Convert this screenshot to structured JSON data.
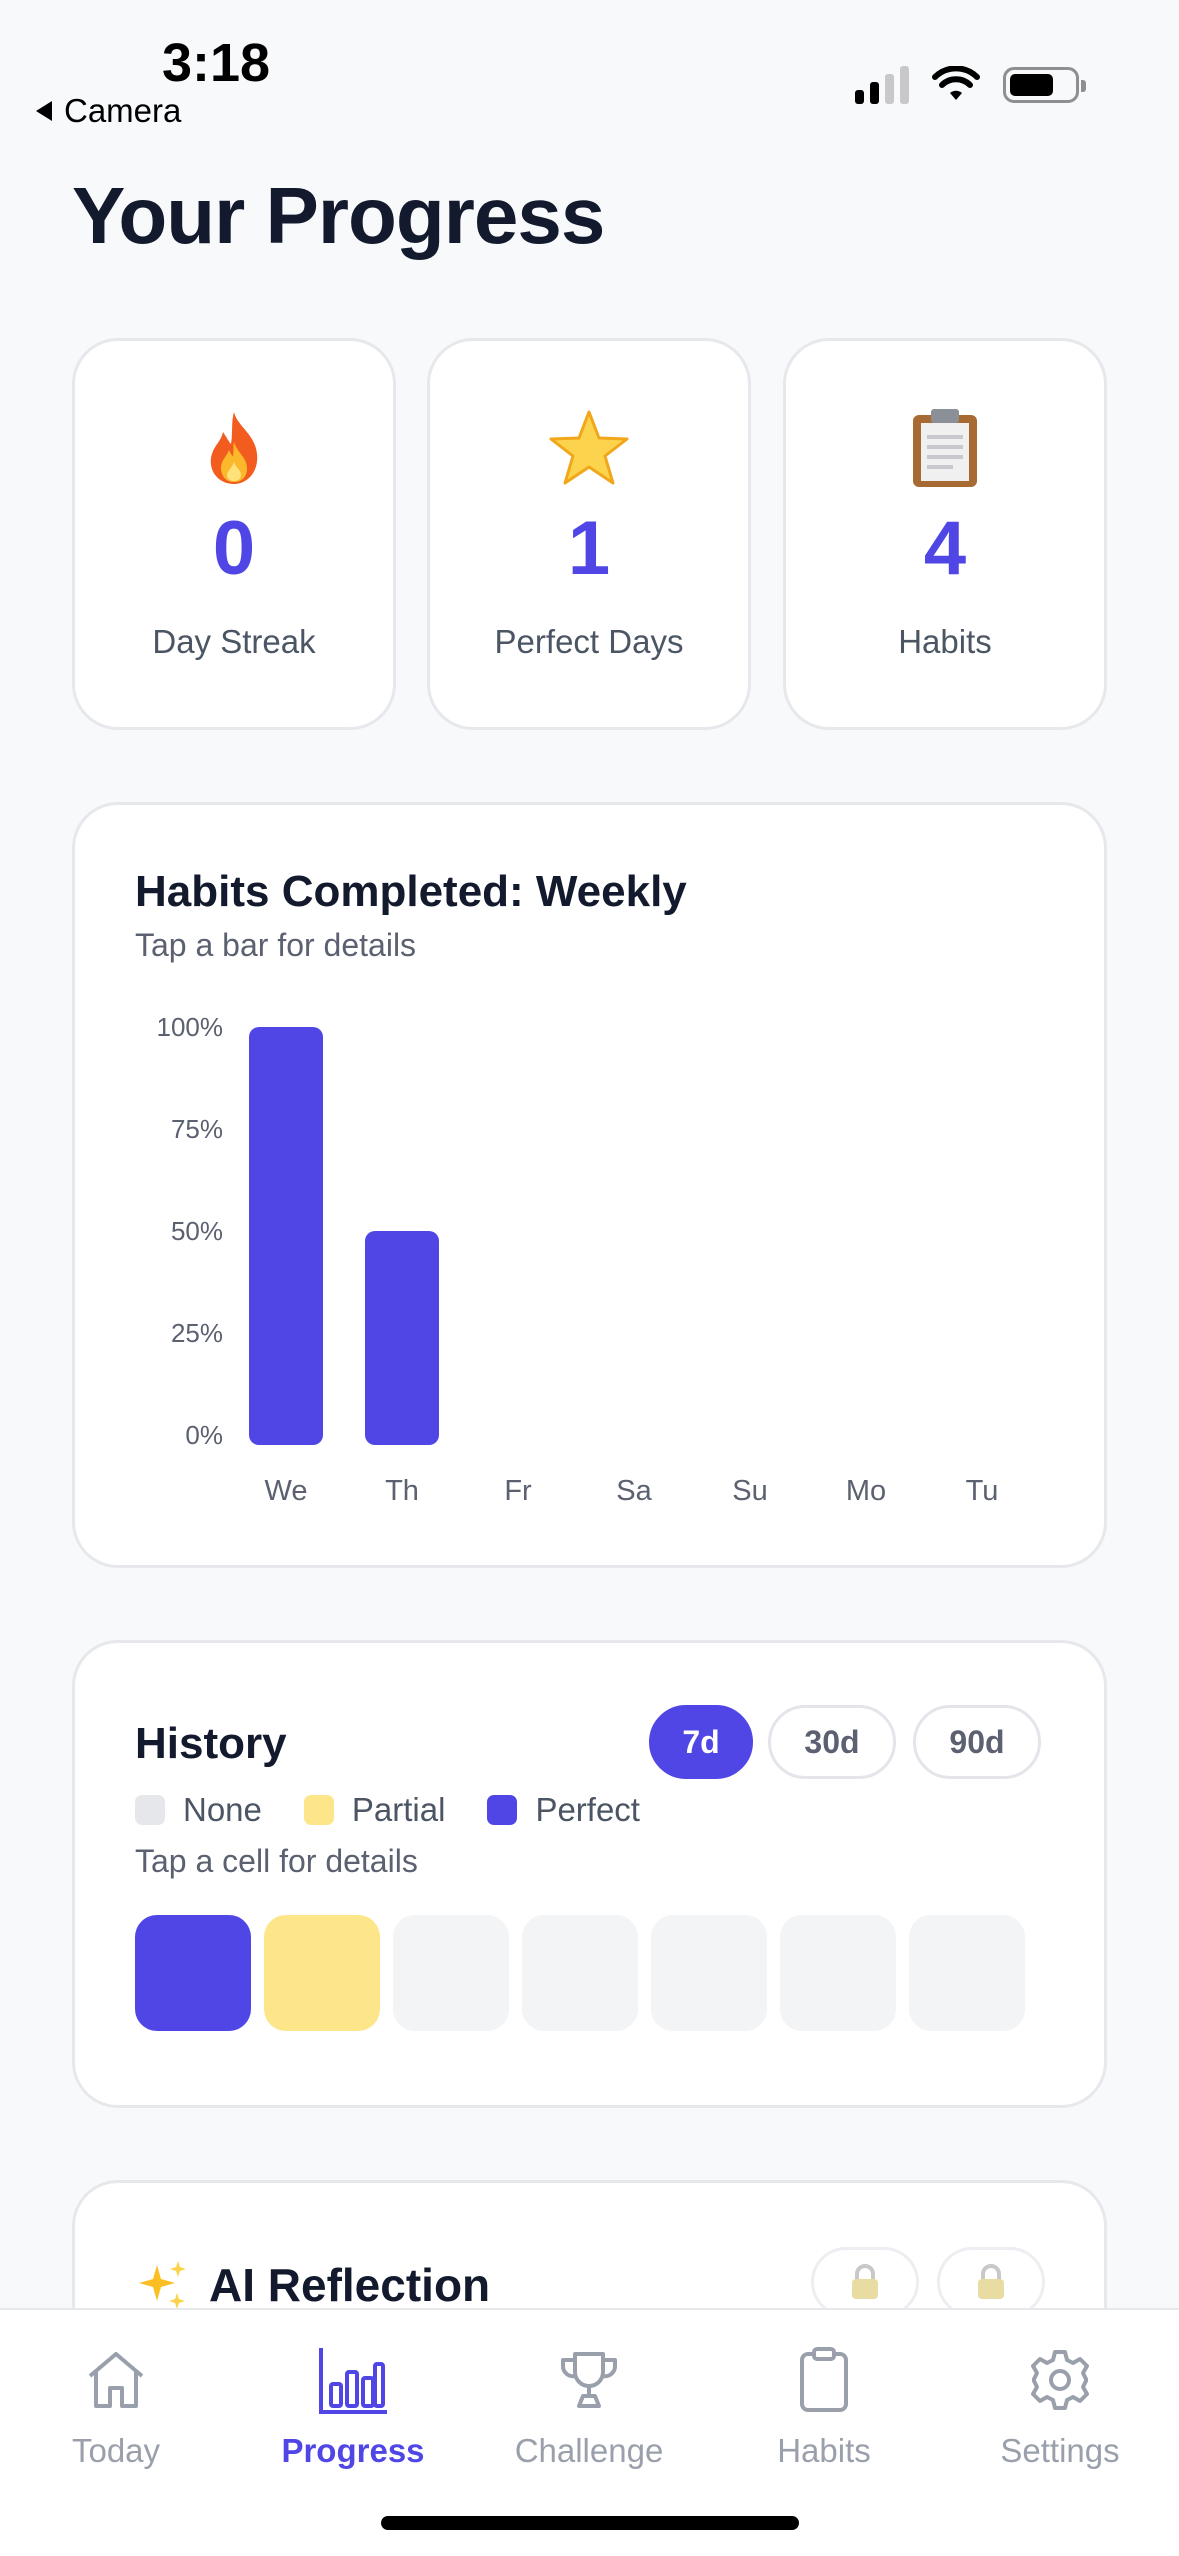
{
  "status": {
    "time": "3:18",
    "back_label": "Camera"
  },
  "page": {
    "title": "Your Progress"
  },
  "stats": [
    {
      "icon": "fire-icon",
      "value": "0",
      "label": "Day Streak"
    },
    {
      "icon": "star-icon",
      "value": "1",
      "label": "Perfect Days"
    },
    {
      "icon": "clipboard-icon",
      "value": "4",
      "label": "Habits"
    }
  ],
  "chart": {
    "title": "Habits Completed: Weekly",
    "subtitle": "Tap a bar for details"
  },
  "chart_data": {
    "type": "bar",
    "categories": [
      "We",
      "Th",
      "Fr",
      "Sa",
      "Su",
      "Mo",
      "Tu"
    ],
    "values": [
      100,
      50,
      0,
      0,
      0,
      0,
      0
    ],
    "yticks": [
      "100%",
      "75%",
      "50%",
      "25%",
      "0%"
    ],
    "ylim": [
      0,
      100
    ],
    "grid": false,
    "bar_color": "#4f46e5"
  },
  "history": {
    "title": "History",
    "ranges": [
      "7d",
      "30d",
      "90d"
    ],
    "active_range": "7d",
    "legend": [
      {
        "label": "None",
        "color": "#e5e7eb"
      },
      {
        "label": "Partial",
        "color": "#fde68a"
      },
      {
        "label": "Perfect",
        "color": "#4f46e5"
      }
    ],
    "hint": "Tap a cell for details",
    "cells": [
      "perfect",
      "partial",
      "none",
      "none",
      "none",
      "none",
      "none"
    ]
  },
  "ai": {
    "title": "AI Reflection",
    "icon": "sparkles-icon"
  },
  "tabs": [
    {
      "label": "Today",
      "icon": "home-icon",
      "active": false
    },
    {
      "label": "Progress",
      "icon": "bar-chart-icon",
      "active": true
    },
    {
      "label": "Challenge",
      "icon": "trophy-icon",
      "active": false
    },
    {
      "label": "Habits",
      "icon": "clipboard-outline-icon",
      "active": false
    },
    {
      "label": "Settings",
      "icon": "gear-icon",
      "active": false
    }
  ],
  "colors": {
    "accent": "#4f46e5",
    "partial": "#fde68a",
    "empty_cell": "#f3f4f6"
  }
}
